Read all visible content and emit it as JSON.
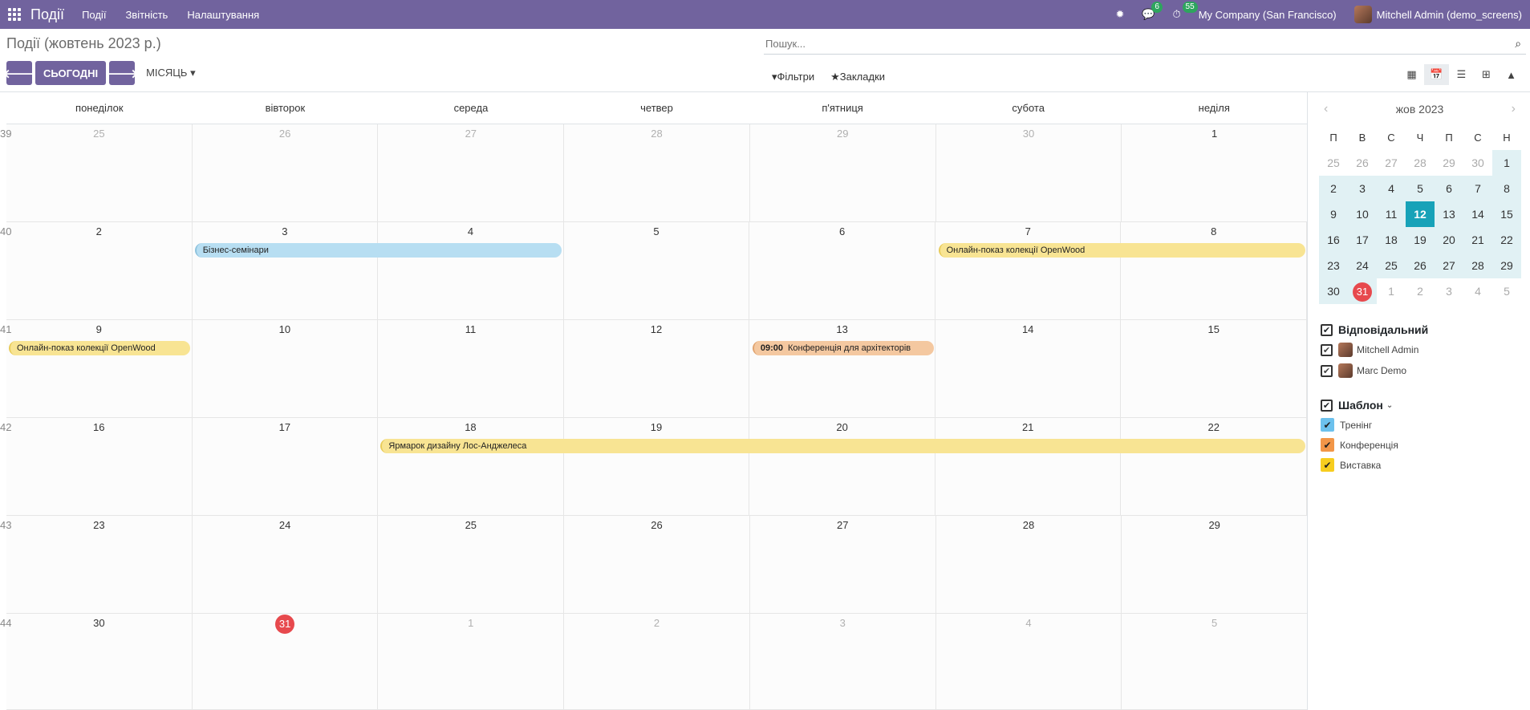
{
  "navbar": {
    "app_name": "Події",
    "menu": [
      "Події",
      "Звітність",
      "Налаштування"
    ],
    "messages_badge": "6",
    "activity_badge": "55",
    "company": "My Company (San Francisco)",
    "user": "Mitchell Admin (demo_screens)"
  },
  "cp": {
    "title": "Події (жовтень 2023 р.)",
    "search_placeholder": "Пошук...",
    "today": "СЬОГОДНІ",
    "scale": "МІСЯЦЬ",
    "filters": "Фільтри",
    "favorites": "Закладки"
  },
  "calendar": {
    "dow": [
      "понеділок",
      "вівторок",
      "середа",
      "четвер",
      "п'ятниця",
      "субота",
      "неділя"
    ],
    "weeks": [
      {
        "wk": "39",
        "days": [
          {
            "n": "25",
            "o": true
          },
          {
            "n": "26",
            "o": true
          },
          {
            "n": "27",
            "o": true
          },
          {
            "n": "28",
            "o": true
          },
          {
            "n": "29",
            "o": true
          },
          {
            "n": "30",
            "o": true
          },
          {
            "n": "1",
            "o": false
          }
        ]
      },
      {
        "wk": "40",
        "days": [
          {
            "n": "2",
            "o": false
          },
          {
            "n": "3",
            "o": false
          },
          {
            "n": "4",
            "o": false
          },
          {
            "n": "5",
            "o": false
          },
          {
            "n": "6",
            "o": false
          },
          {
            "n": "7",
            "o": false
          },
          {
            "n": "8",
            "o": false
          }
        ]
      },
      {
        "wk": "41",
        "days": [
          {
            "n": "9",
            "o": false
          },
          {
            "n": "10",
            "o": false
          },
          {
            "n": "11",
            "o": false
          },
          {
            "n": "12",
            "o": false
          },
          {
            "n": "13",
            "o": false
          },
          {
            "n": "14",
            "o": false
          },
          {
            "n": "15",
            "o": false
          }
        ]
      },
      {
        "wk": "42",
        "days": [
          {
            "n": "16",
            "o": false
          },
          {
            "n": "17",
            "o": false
          },
          {
            "n": "18",
            "o": false
          },
          {
            "n": "19",
            "o": false
          },
          {
            "n": "20",
            "o": false
          },
          {
            "n": "21",
            "o": false
          },
          {
            "n": "22",
            "o": false
          }
        ]
      },
      {
        "wk": "43",
        "days": [
          {
            "n": "23",
            "o": false
          },
          {
            "n": "24",
            "o": false
          },
          {
            "n": "25",
            "o": false
          },
          {
            "n": "26",
            "o": false
          },
          {
            "n": "27",
            "o": false
          },
          {
            "n": "28",
            "o": false
          },
          {
            "n": "29",
            "o": false
          }
        ]
      },
      {
        "wk": "44",
        "days": [
          {
            "n": "30",
            "o": false
          },
          {
            "n": "31",
            "o": false,
            "today": true
          },
          {
            "n": "1",
            "o": true
          },
          {
            "n": "2",
            "o": true
          },
          {
            "n": "3",
            "o": true
          },
          {
            "n": "4",
            "o": true
          },
          {
            "n": "5",
            "o": true
          }
        ]
      }
    ],
    "events": [
      {
        "title": "Бізнес-семінари",
        "week": 1,
        "start": 1,
        "span": 2,
        "color": "blue",
        "time": ""
      },
      {
        "title": "Онлайн-показ колекції OpenWood",
        "week": 1,
        "start": 5,
        "span": 2,
        "color": "yellow",
        "time": ""
      },
      {
        "title": "Онлайн-показ колекції OpenWood",
        "week": 2,
        "start": 0,
        "span": 1,
        "color": "yellow",
        "time": ""
      },
      {
        "title": "Конференція для архітекторів",
        "week": 2,
        "start": 4,
        "span": 1,
        "color": "orange",
        "time": "09:00"
      },
      {
        "title": "Ярмарок дизайну Лос-Анджелеса",
        "week": 3,
        "start": 2,
        "span": 5,
        "color": "yellow",
        "time": ""
      }
    ]
  },
  "mini": {
    "month": "жов 2023",
    "dow": [
      "П",
      "В",
      "С",
      "Ч",
      "П",
      "С",
      "Н"
    ],
    "days": [
      [
        "25",
        "26",
        "27",
        "28",
        "29",
        "30",
        "1"
      ],
      [
        "2",
        "3",
        "4",
        "5",
        "6",
        "7",
        "8"
      ],
      [
        "9",
        "10",
        "11",
        "12",
        "13",
        "14",
        "15"
      ],
      [
        "16",
        "17",
        "18",
        "19",
        "20",
        "21",
        "22"
      ],
      [
        "23",
        "24",
        "25",
        "26",
        "27",
        "28",
        "29"
      ],
      [
        "30",
        "31",
        "1",
        "2",
        "3",
        "4",
        "5"
      ]
    ]
  },
  "sidebar": {
    "resp_title": "Відповідальний",
    "resp": [
      "Mitchell Admin",
      "Marc Demo"
    ],
    "tmpl_title": "Шаблон",
    "tmpl": [
      {
        "label": "Тренінг",
        "color": "#6cc1ed"
      },
      {
        "label": "Конференція",
        "color": "#f29648"
      },
      {
        "label": "Виставка",
        "color": "#f7cd1f"
      }
    ]
  }
}
